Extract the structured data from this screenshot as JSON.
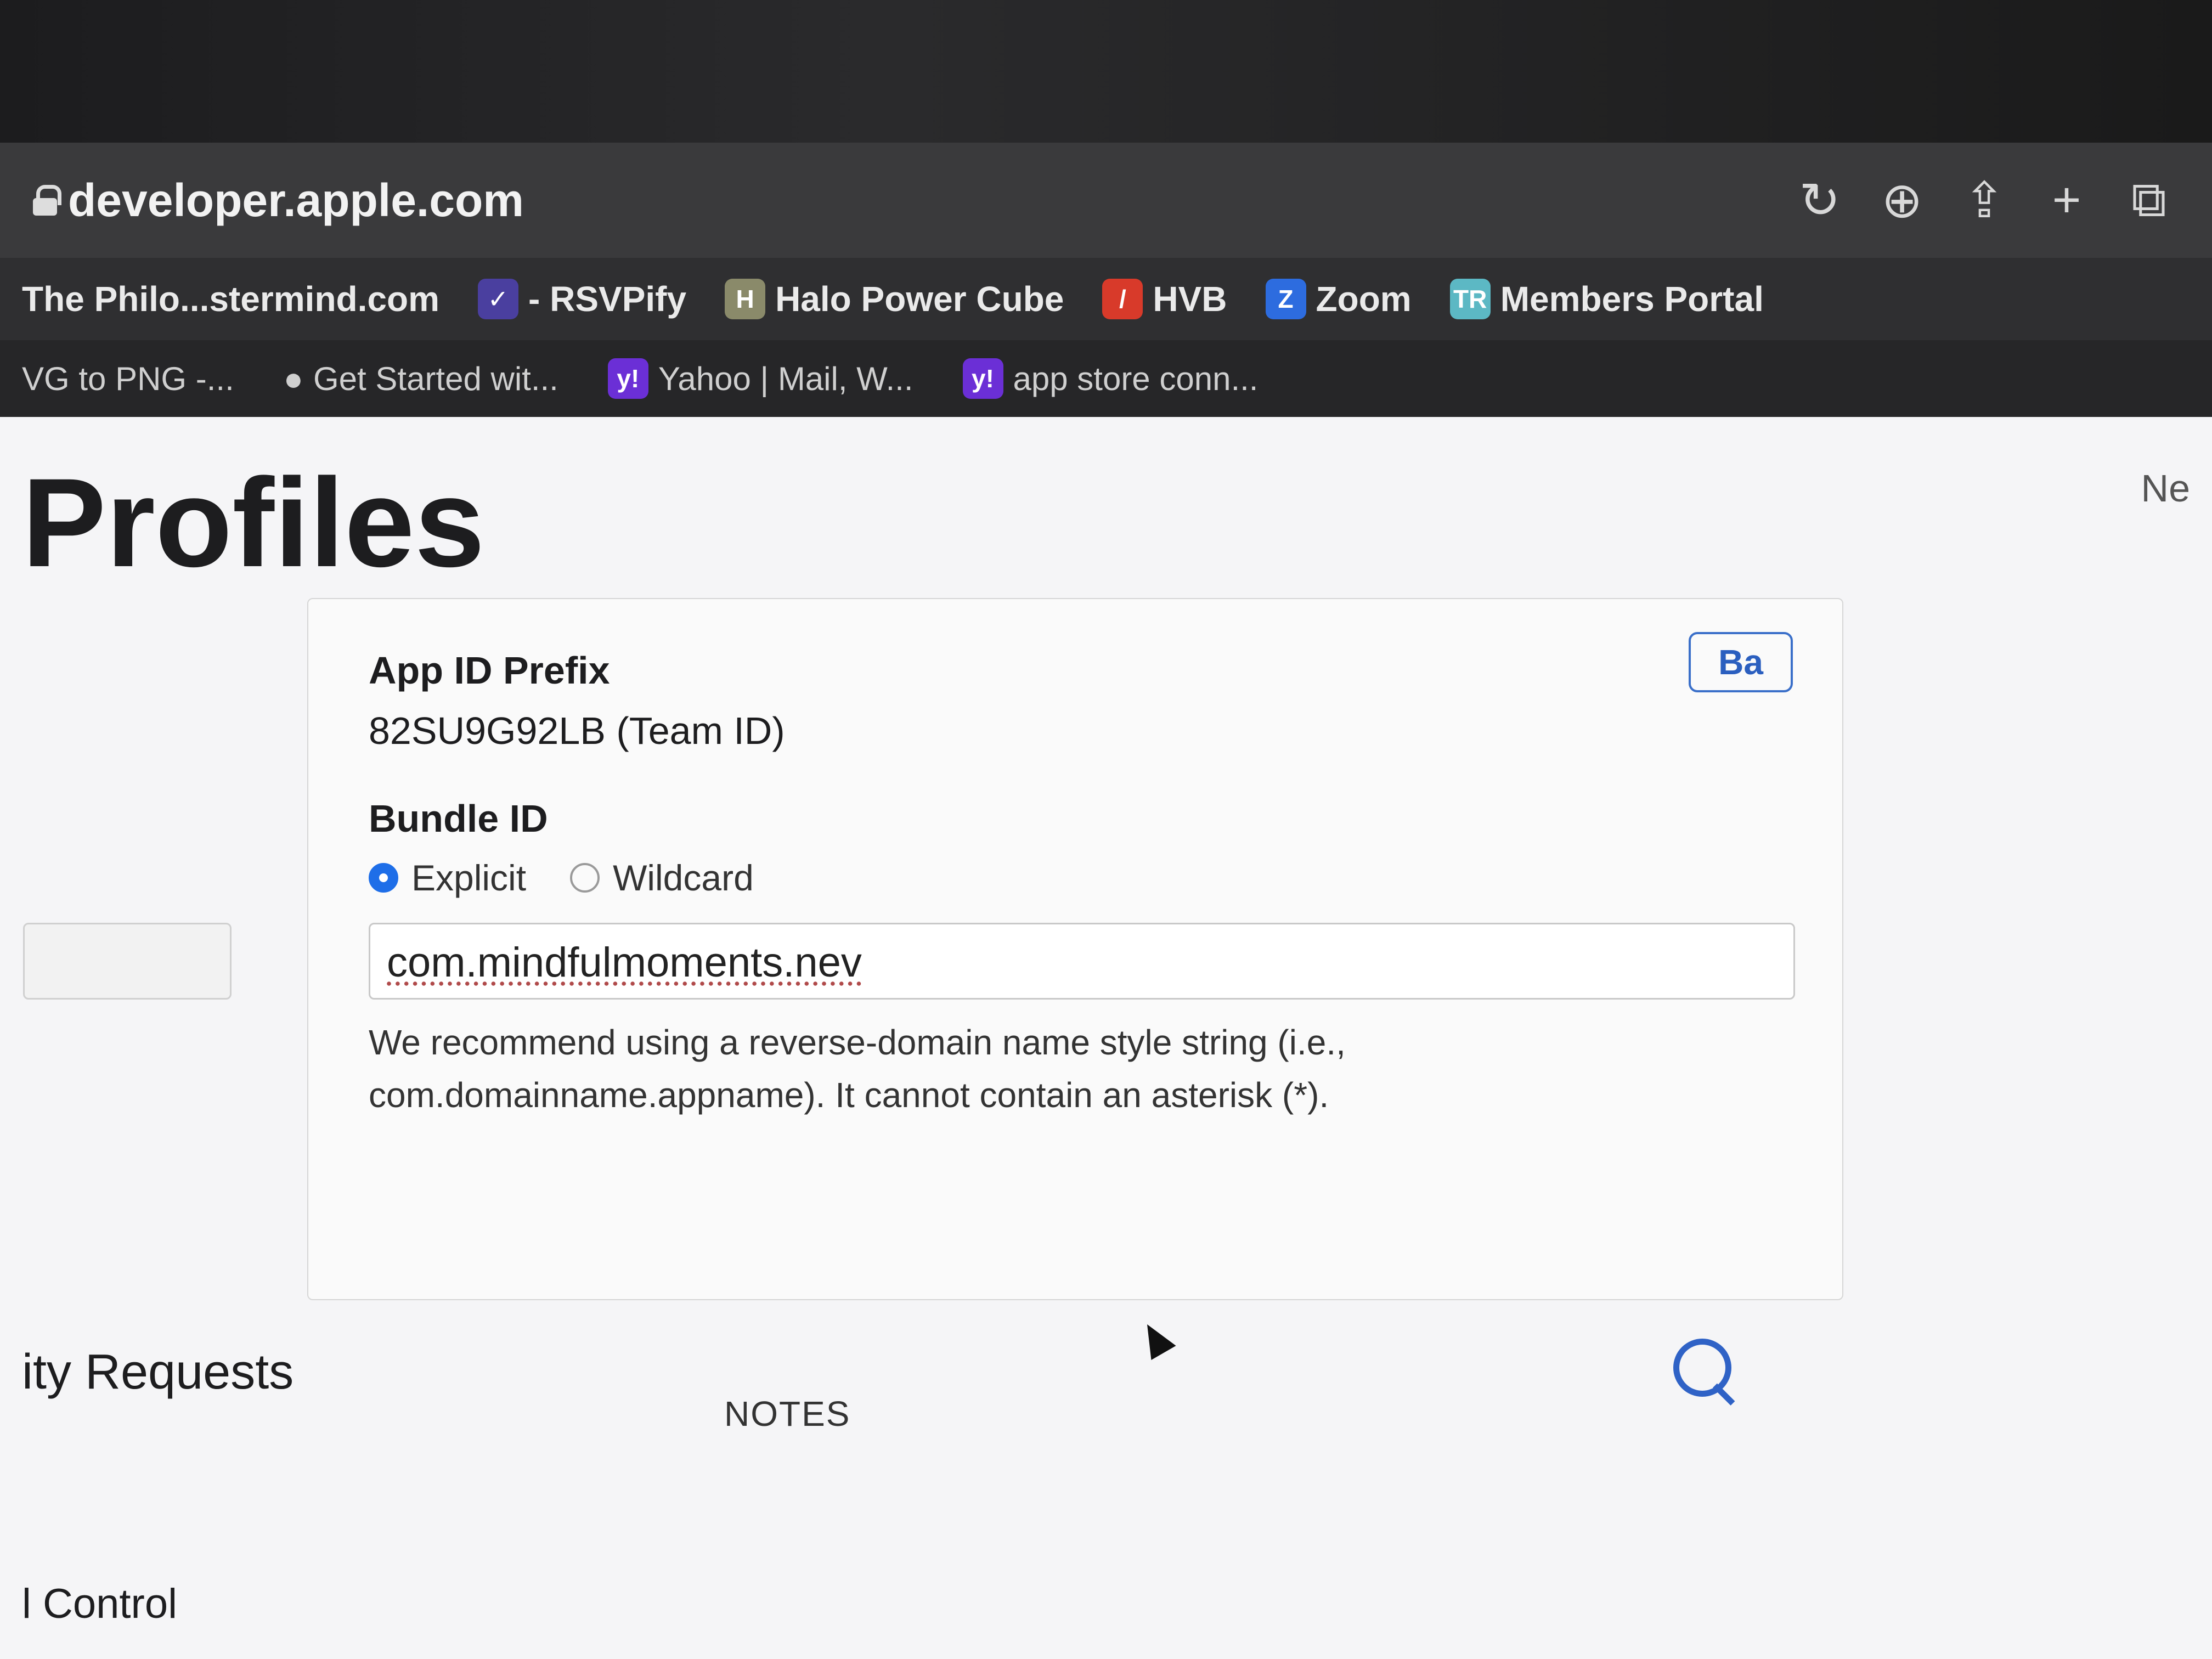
{
  "browser": {
    "url": "developer.apple.com",
    "bookmarks": [
      {
        "label": "The Philo...stermind.com",
        "badge": "",
        "badge_color": ""
      },
      {
        "label": "- RSVPify",
        "badge": "✓",
        "badge_color": "#4a3f9f"
      },
      {
        "label": "Halo Power Cube",
        "badge": "H",
        "badge_color": "#8a8a6a"
      },
      {
        "label": "HVB",
        "badge": "/",
        "badge_color": "#d83a2a"
      },
      {
        "label": "Zoom",
        "badge": "Z",
        "badge_color": "#2d6cdf"
      },
      {
        "label": "Members Portal",
        "badge": "TR",
        "badge_color": "#5cb8c4"
      }
    ],
    "tabs": [
      {
        "label": "VG to PNG -..."
      },
      {
        "label": "Get Started wit..."
      },
      {
        "label": "Yahoo | Mail, W...",
        "badge": "y!"
      },
      {
        "label": "app store conn...",
        "badge": "y!"
      }
    ]
  },
  "page": {
    "title": "Profiles",
    "side_text": "Ne",
    "back_button": "Ba",
    "app_id_prefix": {
      "label": "App ID Prefix",
      "value": "82SU9G92LB (Team ID)"
    },
    "bundle_id": {
      "label": "Bundle ID",
      "options": [
        {
          "label": "Explicit",
          "checked": true
        },
        {
          "label": "Wildcard",
          "checked": false
        }
      ],
      "value": "com.mindfulmoments.nev",
      "hint_line1": "We recommend using a reverse-domain name style string (i.e.,",
      "hint_line2": "com.domainname.appname). It cannot contain an asterisk (*)."
    },
    "left_nav_label": "ity Requests",
    "notes_label": "NOTES",
    "bottom_label": "l Control"
  },
  "colors": {
    "accent": "#1e6ee8",
    "link": "#2f62c6"
  }
}
